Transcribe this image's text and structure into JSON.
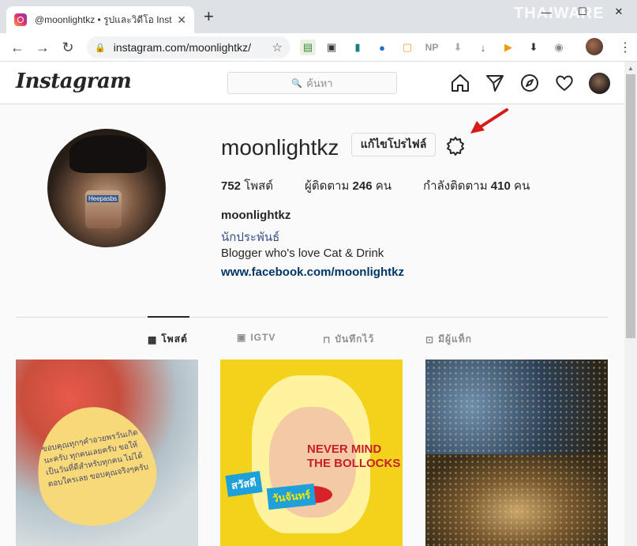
{
  "browser": {
    "tab_title": "@moonlightkz • รูปและวิดีโอ Instag",
    "tab_close": "✕",
    "new_tab": "+",
    "url": "instagram.com/moonlightkz/",
    "watermark": "THAIWARE",
    "ext_np": "NP"
  },
  "instagram": {
    "logo": "Instagram",
    "search_placeholder": "ค้นหา",
    "profile": {
      "username": "moonlightkz",
      "edit_profile_label": "แก้ไขโปรไฟล์",
      "stats": {
        "posts_count": "752",
        "posts_label": "โพสต์",
        "followers_label": "ผู้ติดตาม",
        "followers_count": "246",
        "followers_unit": "คน",
        "following_label": "กำลังติดตาม",
        "following_count": "410",
        "following_unit": "คน"
      },
      "bio": {
        "name": "moonlightkz",
        "category": "นักประพันธ์",
        "text": "Blogger who's love Cat & Drink",
        "link": "www.facebook.com/moonlightkz"
      },
      "photo_label": "Heepasbs"
    },
    "tabs": [
      {
        "label": "โพสต์",
        "icon": "grid-icon",
        "active": true
      },
      {
        "label": "IGTV",
        "icon": "igtv-icon",
        "active": false
      },
      {
        "label": "บันทึกไว้",
        "icon": "bookmark-icon",
        "active": false
      },
      {
        "label": "มีผู้แท็ก",
        "icon": "tagged-icon",
        "active": false
      }
    ],
    "posts": {
      "post1_text": "ขอบคุณทุกๆคำอวยพรวันเกิดนะครับ ทุกคนเลยครับ ขอให้เป็นวันที่ดีสำหรับทุกคน ไม่ได้ตอบใครเลย ขอบคุณจริงๆครับ",
      "post2_headline": "NEVER MIND THE BOLLOCKS",
      "post2_badge1": "สวัสดี",
      "post2_badge2": "วันจันทร์"
    }
  }
}
